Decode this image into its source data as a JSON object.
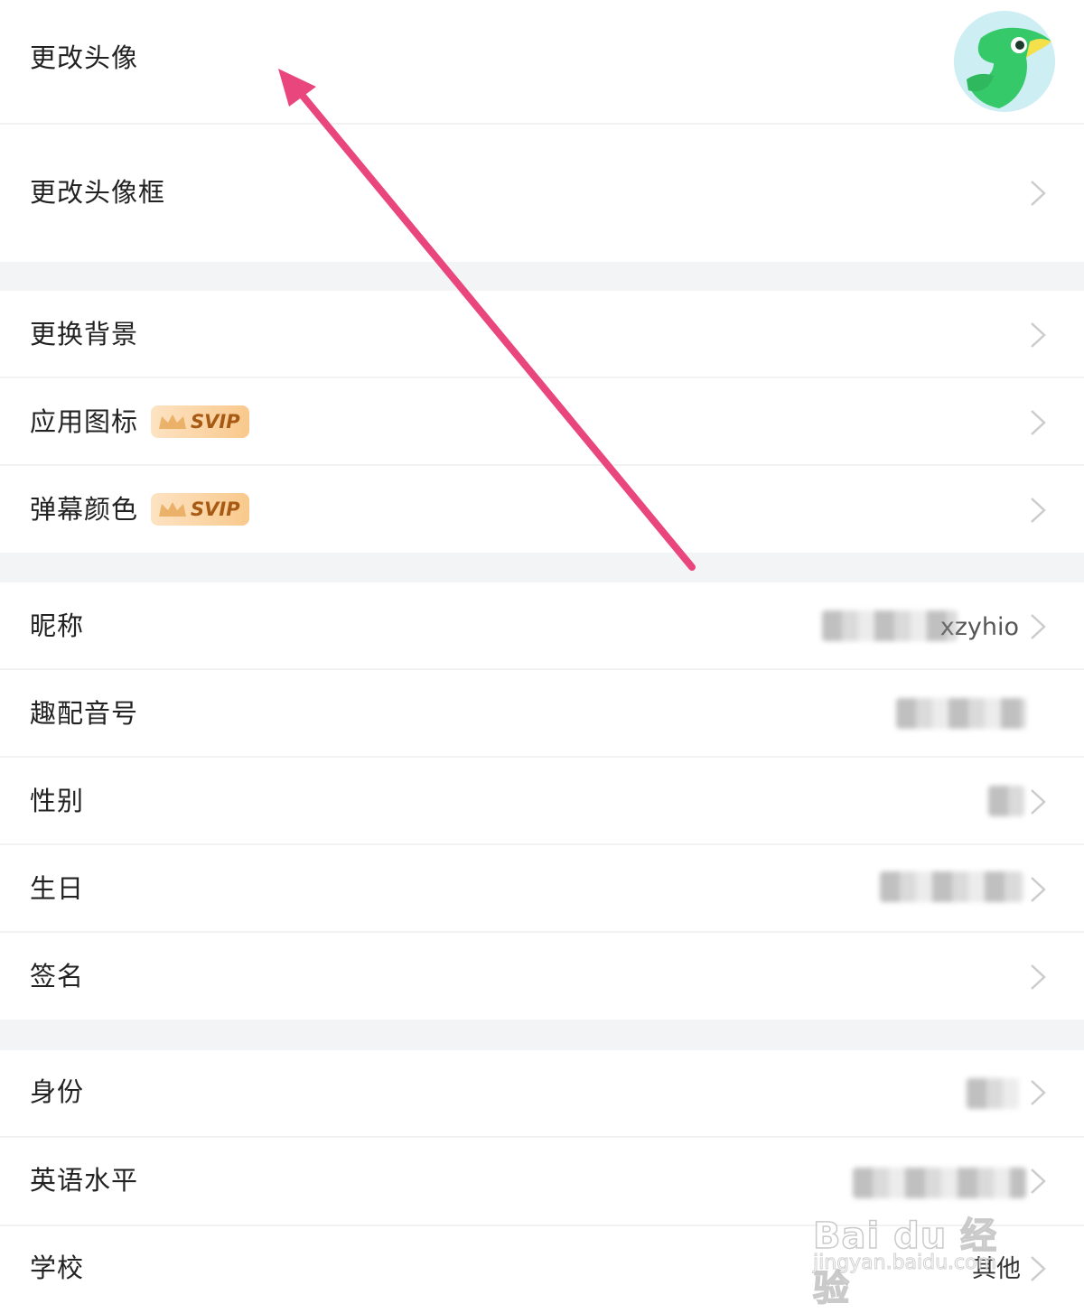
{
  "rows": {
    "avatar": {
      "label": "更改头像"
    },
    "avatar_frame": {
      "label": "更改头像框"
    },
    "background": {
      "label": "更换背景"
    },
    "app_icon": {
      "label": "应用图标",
      "badge": "SVIP"
    },
    "danmaku_color": {
      "label": "弹幕颜色",
      "badge": "SVIP"
    },
    "nickname": {
      "label": "昵称",
      "value": "xzyhio"
    },
    "dub_id": {
      "label": "趣配音号"
    },
    "gender": {
      "label": "性别"
    },
    "birthday": {
      "label": "生日"
    },
    "signature": {
      "label": "签名"
    },
    "identity": {
      "label": "身份"
    },
    "english_level": {
      "label": "英语水平"
    },
    "school": {
      "label": "学校",
      "value": "其他"
    }
  },
  "watermark": {
    "brand": "Bai du 经验",
    "site": "jingyan.baidu.com"
  },
  "colors": {
    "arrow": "#e8467c",
    "section_gap": "#f3f4f6",
    "divider": "#f1f2f4",
    "badge_text": "#a75a14",
    "avatar_bird": "#3ccf6e"
  },
  "icons": {
    "chevron": "chevron-right-icon",
    "badge": "crown-icon",
    "avatar": "green-bird-avatar"
  }
}
